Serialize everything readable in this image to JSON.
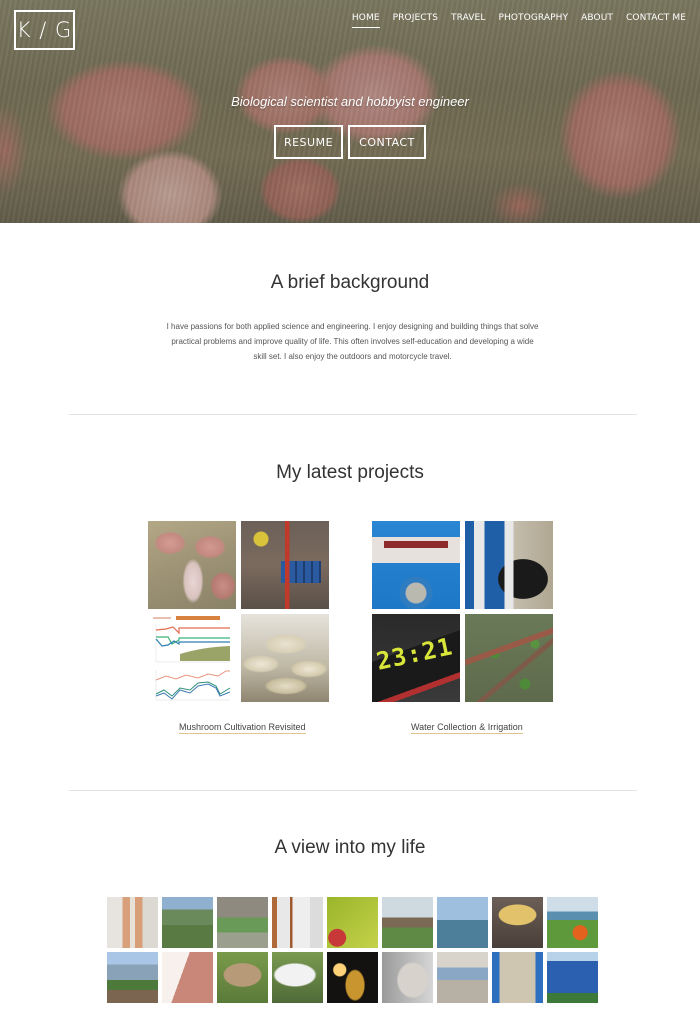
{
  "header": {
    "logo": "K / G",
    "nav": [
      {
        "label": "HOME",
        "active": true
      },
      {
        "label": "PROJECTS",
        "active": false
      },
      {
        "label": "TRAVEL",
        "active": false
      },
      {
        "label": "PHOTOGRAPHY",
        "active": false
      },
      {
        "label": "ABOUT",
        "active": false
      },
      {
        "label": "CONTACT ME",
        "active": false
      }
    ]
  },
  "hero": {
    "tagline": "Biological scientist and hobbyist engineer",
    "buttons": {
      "resume": "RESUME",
      "contact": "CONTACT"
    }
  },
  "background": {
    "title": "A brief background",
    "text": "I have passions for both applied science and engineering. I enjoy designing and building things that solve practical problems and improve quality of life. This often involves self-education and developing a wide skill set. I also enjoy the outdoors and motorcycle travel."
  },
  "projects": {
    "title": "My latest projects",
    "items": [
      {
        "label": "Mushroom Cultivation Revisited",
        "clock_text": ""
      },
      {
        "label": "Water Collection & Irrigation",
        "clock_text": "23:21"
      }
    ]
  },
  "life": {
    "title": "A view into my life",
    "photos": [
      "lab-petri-dishes",
      "soldier-overlooking-valley",
      "soldiers-training",
      "hazmat-suits-team",
      "green-leaf-closeup",
      "man-on-motorcycle",
      "coastal-water",
      "yellow-mushroom",
      "motorcycle-by-lake",
      "volcano-coast",
      "caterpillar-on-hand",
      "fungus-on-log",
      "white-fuzzy-caterpillar",
      "woman-with-lantern",
      "siamese-cat",
      "boat-deck",
      "domed-building",
      "blue-crater-lake"
    ]
  },
  "colors": {
    "link_underline": "#e0c68a",
    "divider": "#e2e2e2",
    "heading": "#333333"
  }
}
